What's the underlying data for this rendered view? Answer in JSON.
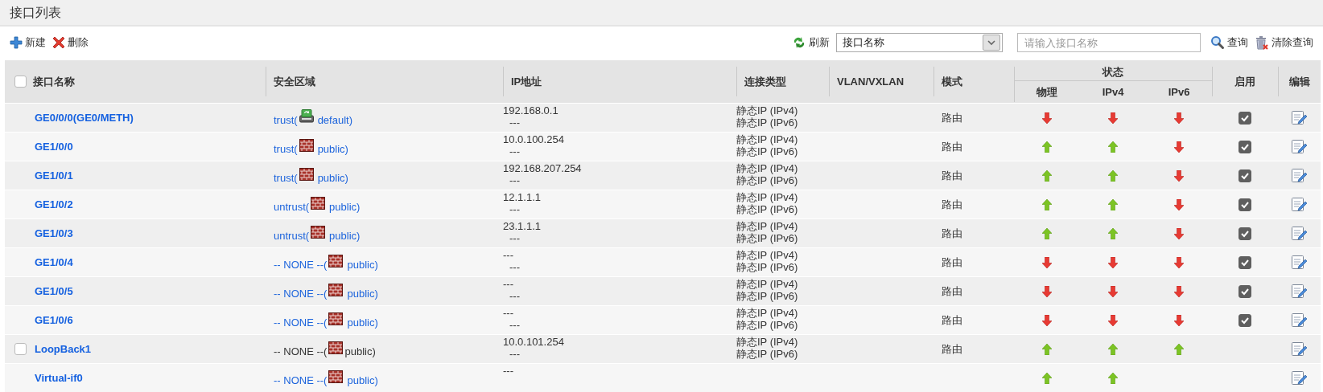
{
  "page": {
    "title": "接口列表"
  },
  "toolbar": {
    "buttons": [
      {
        "label": "新建",
        "kind": "new"
      },
      {
        "label": "删除",
        "kind": "delete"
      }
    ],
    "refresh": "刷新",
    "filter_select": {
      "value": "接口名称"
    },
    "search_field": {
      "placeholder": "请输入接口名称"
    },
    "search": "查询",
    "clear_search": "清除查询"
  },
  "table": {
    "select_all": {
      "checked": false
    },
    "columns": [
      "接口名称",
      "安全区域",
      "IP地址",
      "连接类型",
      "VLAN/VXLAN",
      "模式"
    ],
    "status": {
      "label": "状态",
      "columns": [
        "物理",
        "IPv4",
        "IPv6"
      ]
    },
    "trailing_columns": [
      "启用",
      "编辑"
    ],
    "rows": [
      {
        "name": "GE0/0/0(GE0/METH)",
        "zone": "trust(",
        "zone_linked": true,
        "vsys_root": true,
        "vsys": "default)",
        "ip": [
          "192.168.0.1",
          "---"
        ],
        "link_type": [
          "静态IP (IPv4)",
          "静态IP (IPv6)"
        ],
        "mode": "路由",
        "status_up": [
          false,
          false,
          false
        ],
        "enabled": true
      },
      {
        "name": "GE1/0/0",
        "zone": "trust(",
        "zone_linked": true,
        "vsys_root": false,
        "vsys": "public)",
        "ip": [
          "10.0.100.254",
          "---"
        ],
        "link_type": [
          "静态IP (IPv4)",
          "静态IP (IPv6)"
        ],
        "mode": "路由",
        "status_up": [
          true,
          true,
          false
        ],
        "enabled": true
      },
      {
        "name": "GE1/0/1",
        "zone": "trust(",
        "zone_linked": true,
        "vsys_root": false,
        "vsys": "public)",
        "ip": [
          "192.168.207.254",
          "---"
        ],
        "link_type": [
          "静态IP (IPv4)",
          "静态IP (IPv6)"
        ],
        "mode": "路由",
        "status_up": [
          true,
          true,
          false
        ],
        "enabled": true
      },
      {
        "name": "GE1/0/2",
        "zone": "untrust(",
        "zone_linked": true,
        "vsys_root": false,
        "vsys": "public)",
        "ip": [
          "12.1.1.1",
          "---"
        ],
        "link_type": [
          "静态IP (IPv4)",
          "静态IP (IPv6)"
        ],
        "mode": "路由",
        "status_up": [
          true,
          true,
          false
        ],
        "enabled": true
      },
      {
        "name": "GE1/0/3",
        "zone": "untrust(",
        "zone_linked": true,
        "vsys_root": false,
        "vsys": "public)",
        "ip": [
          "23.1.1.1",
          "---"
        ],
        "link_type": [
          "静态IP (IPv4)",
          "静态IP (IPv6)"
        ],
        "mode": "路由",
        "status_up": [
          true,
          true,
          false
        ],
        "enabled": true
      },
      {
        "name": "GE1/0/4",
        "zone": "-- NONE --(",
        "zone_linked": true,
        "vsys_root": false,
        "vsys": "public)",
        "ip": [
          "---",
          "---"
        ],
        "link_type": [
          "静态IP (IPv4)",
          "静态IP (IPv6)"
        ],
        "mode": "路由",
        "status_up": [
          false,
          false,
          false
        ],
        "enabled": true
      },
      {
        "name": "GE1/0/5",
        "zone": "-- NONE --(",
        "zone_linked": true,
        "vsys_root": false,
        "vsys": "public)",
        "ip": [
          "---",
          "---"
        ],
        "link_type": [
          "静态IP (IPv4)",
          "静态IP (IPv6)"
        ],
        "mode": "路由",
        "status_up": [
          false,
          false,
          false
        ],
        "enabled": true
      },
      {
        "name": "GE1/0/6",
        "zone": "-- NONE --(",
        "zone_linked": true,
        "vsys_root": false,
        "vsys": "public)",
        "ip": [
          "---",
          "---"
        ],
        "link_type": [
          "静态IP (IPv4)",
          "静态IP (IPv6)"
        ],
        "mode": "路由",
        "status_up": [
          false,
          false,
          false
        ],
        "enabled": true
      },
      {
        "name": "LoopBack1",
        "selected": false,
        "zone": "-- NONE --(",
        "zone_linked": false,
        "vsys_root": false,
        "vsys": "public)",
        "ip": [
          "10.0.101.254",
          "---"
        ],
        "link_type": [
          "静态IP (IPv4)",
          "静态IP (IPv6)"
        ],
        "mode": "路由",
        "status_up": [
          true,
          true,
          true
        ]
      },
      {
        "name": "Virtual-if0",
        "zone": "-- NONE --(",
        "zone_linked": true,
        "vsys_root": false,
        "vsys": "public)",
        "ip": [
          "---"
        ],
        "status_up": [
          true,
          true
        ]
      }
    ]
  }
}
